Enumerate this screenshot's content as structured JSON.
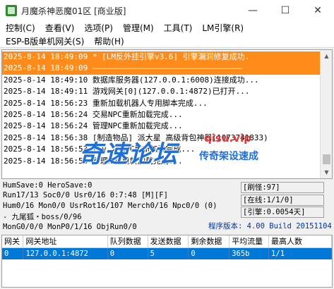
{
  "window": {
    "title": "月魔杀神恶魔01区 [商业版]",
    "controls": [
      "—",
      "☐",
      "✕"
    ]
  },
  "menu": {
    "row1": [
      "控制(C)",
      "查看(V)",
      "选项(P)",
      "管理(M)",
      "工具(T)",
      "LM引擎(R)"
    ],
    "row2": [
      "ESP-B版单机网关(S)",
      "帮助(H)"
    ]
  },
  "log": {
    "lines": [
      "2025-8-14 18:49:09 * [LM反外挂引擎v3.6] 引擎漏洞修复成功.",
      "2025-8-14 18:49:09 ————————————————————————————————",
      "2025-8-14 18:49:10 数据库服务器(127.0.0.1:6008)连接成功...",
      "2025-8-14 18:49:11 游戏网关[0](127.0.0.1:4872)已打开...",
      "2025-8-14 18:56:23 重新加载机器人专用脚本完成...",
      "2025-8-14 18:56:24 交易NPC重新加载完成...",
      "2025-8-14 18:56:24 管理NPC重新加载完成...",
      "2025-8-14 18:56:38 [制造物品] 派大星 高级背包神器(1073741833)",
      "2025-8-14 18:56:53 [Lv…] NPC重新加载完成...",
      "2025-8-14 18:56:53 管理NPC重新加载完成..."
    ],
    "highlight_color": "#ff8c1a"
  },
  "watermark": {
    "main": "奇速论坛",
    "url": "qisu.vip",
    "sub": "传奇架设速成"
  },
  "status": {
    "line1": "HumSave:0 HeroSave:0",
    "line2": "Run17/13 Soc0/0 Usr0/16          0:7:48 [M][F]",
    "line3": "Hum0/16 Mon0/0 UsrRot16/107 Merch0/16 Npc0/0 (0)",
    "line4": " - 九尾狐・boss/0/96",
    "line5": "MonG0/0/0 MonP0/1/16 ObjRun0/0",
    "refresh": "[刷怪:97]",
    "online": "[在线:1/1/0]",
    "engine": "[引擎:0.0054天]",
    "version_label": "程序版本:",
    "version_value": "4.00 Build 20151104"
  },
  "gateway_table": {
    "headers": [
      "网关",
      "网关地址",
      "队列数据",
      "发送数据",
      "剩余数据",
      "平均流量",
      "最高人数"
    ],
    "rows": [
      [
        "0",
        "127.0.0.1:4872",
        "0",
        "5",
        "0",
        "365b",
        "1/1"
      ]
    ],
    "selected_color": "#0078d7"
  }
}
